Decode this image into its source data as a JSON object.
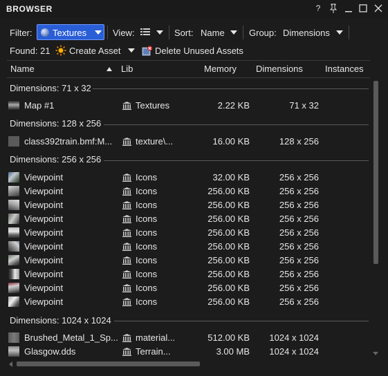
{
  "window": {
    "title": "BROWSER",
    "buttons": {
      "help": "?",
      "pin": "pin-icon",
      "minimize": "minimize-icon",
      "maximize": "maximize-icon",
      "close": "close-icon"
    }
  },
  "toolbar": {
    "filter_label": "Filter:",
    "filter_value": "Textures",
    "view_label": "View:",
    "sort_label": "Sort:",
    "sort_value": "Name",
    "group_label": "Group:",
    "group_value": "Dimensions"
  },
  "actions": {
    "found": "Found: 21",
    "create_asset": "Create Asset",
    "delete_unused": "Delete Unused Assets"
  },
  "columns": {
    "name": "Name",
    "lib": "Lib",
    "memory": "Memory",
    "dimensions": "Dimensions",
    "instances": "Instances"
  },
  "groups": [
    {
      "header": "Dimensions: 71 x 32",
      "rows": [
        {
          "name": "Map #1",
          "lib": "Textures",
          "memory": "2.22 KB",
          "dims": "71 x 32",
          "thumb": "dark-gradient"
        }
      ]
    },
    {
      "header": "Dimensions: 128 x 256",
      "rows": [
        {
          "name": "class392train.bmf:M...",
          "lib": "texture\\...",
          "memory": "16.00 KB",
          "dims": "128 x 256",
          "thumb": "gray"
        }
      ]
    },
    {
      "header": "Dimensions: 256 x 256",
      "rows": [
        {
          "name": "Viewpoint",
          "lib": "Icons",
          "memory": "32.00 KB",
          "dims": "256 x 256",
          "thumb": "photo"
        },
        {
          "name": "Viewpoint",
          "lib": "Icons",
          "memory": "256.00 KB",
          "dims": "256 x 256",
          "thumb": "photo"
        },
        {
          "name": "Viewpoint",
          "lib": "Icons",
          "memory": "256.00 KB",
          "dims": "256 x 256",
          "thumb": "photo"
        },
        {
          "name": "Viewpoint",
          "lib": "Icons",
          "memory": "256.00 KB",
          "dims": "256 x 256",
          "thumb": "photo"
        },
        {
          "name": "Viewpoint",
          "lib": "Icons",
          "memory": "256.00 KB",
          "dims": "256 x 256",
          "thumb": "photo"
        },
        {
          "name": "Viewpoint",
          "lib": "Icons",
          "memory": "256.00 KB",
          "dims": "256 x 256",
          "thumb": "photo"
        },
        {
          "name": "Viewpoint",
          "lib": "Icons",
          "memory": "256.00 KB",
          "dims": "256 x 256",
          "thumb": "photo"
        },
        {
          "name": "Viewpoint",
          "lib": "Icons",
          "memory": "256.00 KB",
          "dims": "256 x 256",
          "thumb": "photo"
        },
        {
          "name": "Viewpoint",
          "lib": "Icons",
          "memory": "256.00 KB",
          "dims": "256 x 256",
          "thumb": "photo"
        },
        {
          "name": "Viewpoint",
          "lib": "Icons",
          "memory": "256.00 KB",
          "dims": "256 x 256",
          "thumb": "photo"
        }
      ]
    },
    {
      "header": "Dimensions: 1024 x 1024",
      "rows": [
        {
          "name": "Brushed_Metal_1_Sp...",
          "lib": "material...",
          "memory": "512.00 KB",
          "dims": "1024 x 1024",
          "thumb": "metal"
        },
        {
          "name": "Glasgow.dds",
          "lib": "Terrain...",
          "memory": "3.00 MB",
          "dims": "1024 x 1024",
          "thumb": "photo"
        }
      ]
    }
  ],
  "colors": {
    "accent": "#2a5ed7",
    "background": "#1c1c1c",
    "text": "#e6e6e6"
  }
}
